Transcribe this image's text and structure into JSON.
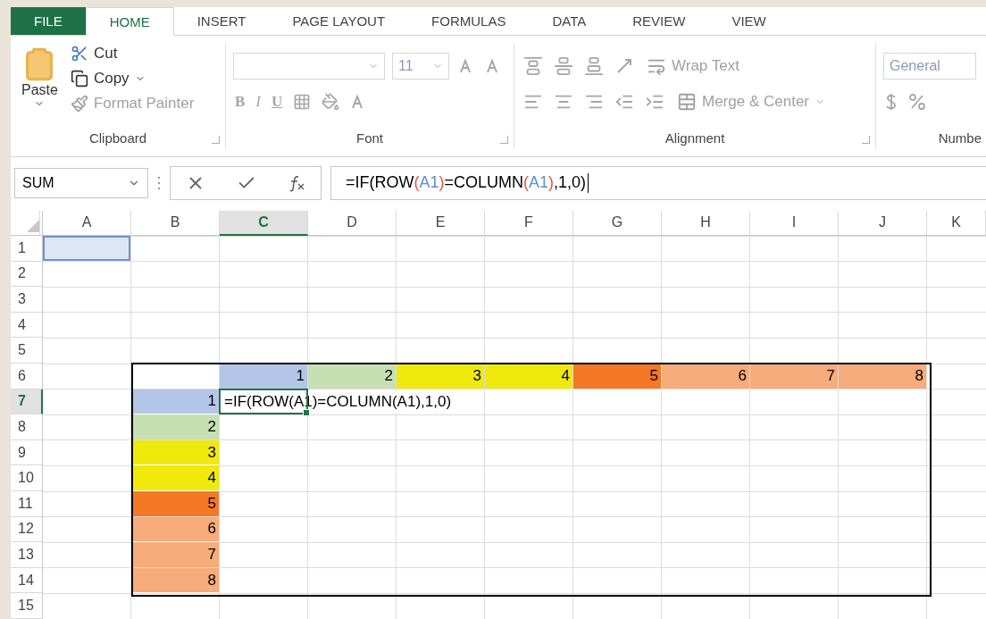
{
  "tabs": [
    {
      "label": "FILE",
      "kind": "file",
      "selected": false
    },
    {
      "label": "HOME",
      "kind": "tab",
      "selected": true
    },
    {
      "label": "INSERT",
      "kind": "tab",
      "selected": false
    },
    {
      "label": "PAGE LAYOUT",
      "kind": "tab",
      "selected": false
    },
    {
      "label": "FORMULAS",
      "kind": "tab",
      "selected": false
    },
    {
      "label": "DATA",
      "kind": "tab",
      "selected": false
    },
    {
      "label": "REVIEW",
      "kind": "tab",
      "selected": false
    },
    {
      "label": "VIEW",
      "kind": "tab",
      "selected": false
    }
  ],
  "ribbon": {
    "clipboard": {
      "label": "Clipboard",
      "paste": "Paste",
      "cut": "Cut",
      "copy": "Copy",
      "format_painter": {
        "label": "Format Painter",
        "disabled": true
      }
    },
    "font": {
      "label": "Font",
      "size": "11",
      "bold": "B",
      "italic": "I",
      "underline": "U",
      "disabled": true
    },
    "alignment": {
      "label": "Alignment",
      "wrap_text": "Wrap Text",
      "merge_center": "Merge & Center",
      "disabled": true
    },
    "number": {
      "label": "Numbe",
      "format": "General",
      "disabled": true
    }
  },
  "formula_bar": {
    "name_box": "SUM",
    "formula": [
      {
        "text": "=IF(ROW",
        "color": "#000000"
      },
      {
        "text": "(",
        "color": "#e8524a"
      },
      {
        "text": "A1",
        "color": "#5b8fd6"
      },
      {
        "text": ")",
        "color": "#e8524a"
      },
      {
        "text": "=COLUMN",
        "color": "#000000"
      },
      {
        "text": "(",
        "color": "#e8524a"
      },
      {
        "text": "A1",
        "color": "#5b8fd6"
      },
      {
        "text": ")",
        "color": "#e8524a"
      },
      {
        "text": ",1,0)",
        "color": "#000000"
      }
    ]
  },
  "grid": {
    "columns": [
      {
        "label": "A",
        "selected": false
      },
      {
        "label": "B",
        "selected": false
      },
      {
        "label": "C",
        "selected": true
      },
      {
        "label": "D",
        "selected": false
      },
      {
        "label": "E",
        "selected": false
      },
      {
        "label": "F",
        "selected": false
      },
      {
        "label": "G",
        "selected": false
      },
      {
        "label": "H",
        "selected": false
      },
      {
        "label": "I",
        "selected": false
      },
      {
        "label": "J",
        "selected": false
      },
      {
        "label": "K",
        "selected": false
      }
    ],
    "rows": [
      {
        "label": "1",
        "selected": false,
        "cells": [
          {
            "highlighted": true
          },
          {},
          {},
          {},
          {},
          {},
          {},
          {},
          {},
          {},
          {}
        ]
      },
      {
        "label": "2",
        "selected": false,
        "cells": [
          {},
          {},
          {},
          {},
          {},
          {},
          {},
          {},
          {},
          {},
          {}
        ]
      },
      {
        "label": "3",
        "selected": false,
        "cells": [
          {},
          {},
          {},
          {},
          {},
          {},
          {},
          {},
          {},
          {},
          {}
        ]
      },
      {
        "label": "4",
        "selected": false,
        "cells": [
          {},
          {},
          {},
          {},
          {},
          {},
          {},
          {},
          {},
          {},
          {}
        ]
      },
      {
        "label": "5",
        "selected": false,
        "cells": [
          {},
          {},
          {},
          {},
          {},
          {},
          {},
          {},
          {},
          {},
          {}
        ]
      },
      {
        "label": "6",
        "selected": false,
        "cells": [
          {},
          {},
          {
            "text": "1",
            "color": "#b4c6e7"
          },
          {
            "text": "2",
            "color": "#c6e0b4"
          },
          {
            "text": "3",
            "color": "#f0ea0c"
          },
          {
            "text": "4",
            "color": "#f0ea0c"
          },
          {
            "text": "5",
            "color": "#f47826"
          },
          {
            "text": "6",
            "color": "#f8ab7b"
          },
          {
            "text": "7",
            "color": "#f8ab7b"
          },
          {
            "text": "8",
            "color": "#f8ab7b"
          },
          {}
        ]
      },
      {
        "label": "7",
        "selected": true,
        "cells": [
          {},
          {
            "text": "1",
            "color": "#b4c6e7"
          },
          {
            "text": "=IF(ROW(A1)=COLUMN(A1),1,0)",
            "active": true
          },
          {},
          {},
          {},
          {},
          {},
          {},
          {},
          {}
        ]
      },
      {
        "label": "8",
        "selected": false,
        "cells": [
          {},
          {
            "text": "2",
            "color": "#c6e0b4"
          },
          {},
          {},
          {},
          {},
          {},
          {},
          {},
          {},
          {}
        ]
      },
      {
        "label": "9",
        "selected": false,
        "cells": [
          {},
          {
            "text": "3",
            "color": "#f0ea0c"
          },
          {},
          {},
          {},
          {},
          {},
          {},
          {},
          {},
          {}
        ]
      },
      {
        "label": "10",
        "selected": false,
        "cells": [
          {},
          {
            "text": "4",
            "color": "#f0ea0c"
          },
          {},
          {},
          {},
          {},
          {},
          {},
          {},
          {},
          {}
        ]
      },
      {
        "label": "11",
        "selected": false,
        "cells": [
          {},
          {
            "text": "5",
            "color": "#f47826"
          },
          {},
          {},
          {},
          {},
          {},
          {},
          {},
          {},
          {}
        ]
      },
      {
        "label": "12",
        "selected": false,
        "cells": [
          {},
          {
            "text": "6",
            "color": "#f8ab7b"
          },
          {},
          {},
          {},
          {},
          {},
          {},
          {},
          {},
          {}
        ]
      },
      {
        "label": "13",
        "selected": false,
        "cells": [
          {},
          {
            "text": "7",
            "color": "#f8ab7b"
          },
          {},
          {},
          {},
          {},
          {},
          {},
          {},
          {},
          {}
        ]
      },
      {
        "label": "14",
        "selected": false,
        "cells": [
          {},
          {
            "text": "8",
            "color": "#f8ab7b"
          },
          {},
          {},
          {},
          {},
          {},
          {},
          {},
          {},
          {}
        ]
      },
      {
        "label": "15",
        "selected": false,
        "cells": [
          {},
          {},
          {},
          {},
          {},
          {},
          {},
          {},
          {},
          {},
          {}
        ]
      }
    ]
  }
}
